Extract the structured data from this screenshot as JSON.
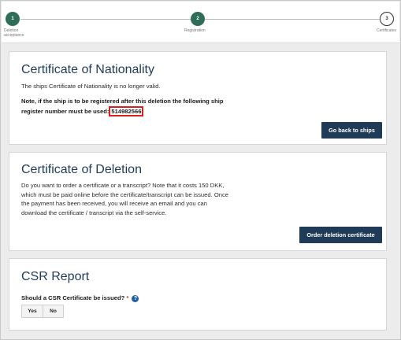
{
  "stepper": {
    "steps": [
      {
        "number": "1",
        "label_line1": "Deletion",
        "label_line2": "acceptance"
      },
      {
        "number": "2",
        "label_line1": "Registration",
        "label_line2": ""
      },
      {
        "number": "3",
        "label_line1": "Certificates",
        "label_line2": ""
      }
    ],
    "colors": {
      "done": "#2e6e59",
      "todo": "#ffffff"
    }
  },
  "nationality": {
    "title": "Certificate of Nationality",
    "text": "The ships Certificate of Nationality is no longer valid.",
    "note_line1": "Note, if the ship is to be registered after this deletion the following ship",
    "note_line2": "register number must be used:",
    "register_number": "514982566",
    "button": "Go back to ships"
  },
  "deletion": {
    "title": "Certificate of Deletion",
    "lines": [
      "Do you want to order a certificate or a transcript? Note that it costs 150 DKK,",
      "which must be paid online before the certificate/transcript can be issued. Once",
      "the payment has been received, you will receive an email and you can",
      "download the certificate / transcript via the self-service."
    ],
    "button": "Order deletion certificate"
  },
  "csr": {
    "title": "CSR Report",
    "question": "Should a CSR Certificate be issued?",
    "required_mark": "*",
    "help_icon": "?",
    "yes": "Yes",
    "no": "No"
  },
  "colors": {
    "accent": "#1f3b57",
    "highlight": "#d8211c"
  }
}
